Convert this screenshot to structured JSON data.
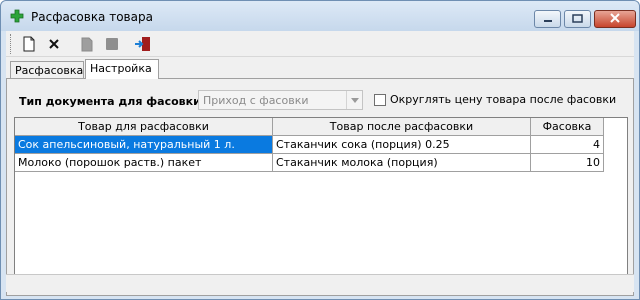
{
  "window": {
    "title": "Расфасовка товара",
    "icon": "green-plus-icon",
    "buttons": [
      "minimize-icon",
      "maximize-icon",
      "close-icon"
    ]
  },
  "toolbar": {
    "items": [
      "new-document-icon",
      "delete-icon",
      "copy-icon-disabled",
      "save-icon-disabled",
      "exit-icon"
    ]
  },
  "tabs": [
    {
      "label": "Расфасовка",
      "active": false
    },
    {
      "label": "Настройка",
      "active": true
    }
  ],
  "settings": {
    "doc_type_label": "Тип документа для фасовки",
    "doc_type_value": "Приход с фасовки",
    "round_price_label": "Округлять цену товара после фасовки",
    "round_price_checked": false
  },
  "grid": {
    "columns": [
      "Товар для расфасовки",
      "Товар после расфасовки",
      "Фасовка"
    ],
    "rows": [
      {
        "source": "Сок апельсиновый, натуральный 1 л.",
        "target": "Стаканчик сока (порция) 0.25",
        "pack": "4",
        "selected": true
      },
      {
        "source": "Молоко (порошок раств.) пакет",
        "target": "Стаканчик молока (порция)",
        "pack": "10",
        "selected": false
      }
    ]
  },
  "colors": {
    "selection": "#0a7ae0",
    "titlebar": "#c6d8ec",
    "close_button": "#c7442c"
  }
}
